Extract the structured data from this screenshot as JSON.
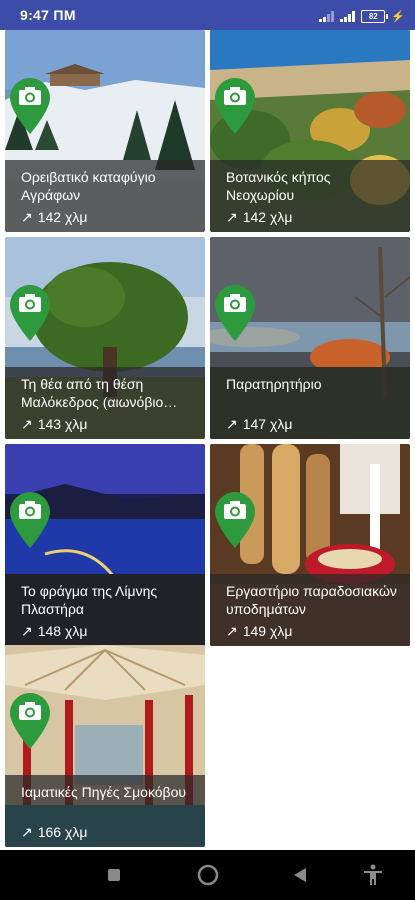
{
  "status_bar": {
    "time": "9:47 ΠΜ",
    "battery": "82"
  },
  "places": [
    {
      "name": "Ορειβατικό καταφύγιο Αγράφων",
      "distance": "142 χλμ"
    },
    {
      "name": "Βοτανικός κήπος Νεοχωρίου",
      "distance": "142 χλμ"
    },
    {
      "name": "Τη θέα από τη θέση Μαλόκεδρος (αιωνόβιο κέδρο)",
      "distance": "143 χλμ"
    },
    {
      "name": "Παρατηρητήριο",
      "distance": "147 χλμ"
    },
    {
      "name": "Το φράγμα της Λίμνης Πλαστήρα",
      "distance": "148 χλμ"
    },
    {
      "name": "Εργαστήριο παραδοσιακών υποδημάτων",
      "distance": "149 χλμ"
    },
    {
      "name": "Ιαματικές Πηγές Σμοκόβου",
      "distance": "166 χλμ"
    }
  ],
  "icons": {
    "pin": "camera-pin-icon",
    "distance": "north-east-arrow-icon",
    "nav": [
      "recents-square-icon",
      "home-circle-icon",
      "back-triangle-icon",
      "accessibility-icon"
    ]
  },
  "colors": {
    "status_bar": "#3d4ca8",
    "pin_green": "#2e9a3e",
    "caption_overlay": "rgba(40,40,40,0.72)"
  }
}
